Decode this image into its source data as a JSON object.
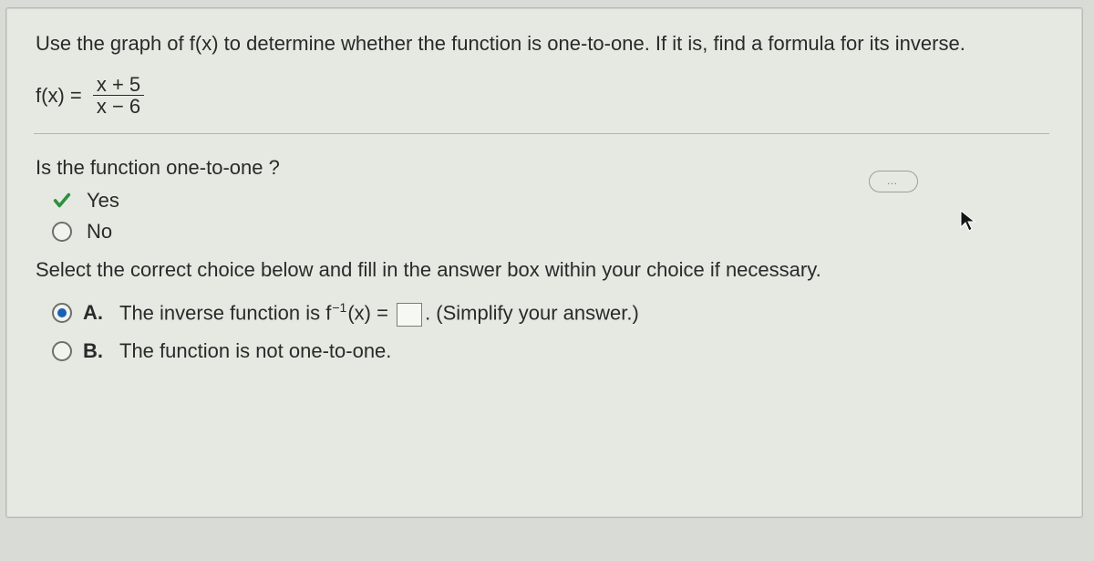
{
  "prompt": "Use the graph of f(x) to determine whether the function is one-to-one. If it is, find a formula for its inverse.",
  "function": {
    "lhs": "f(x) =",
    "numerator": "x + 5",
    "denominator": "x − 6"
  },
  "more_label": "…",
  "question1": "Is the function one-to-one ?",
  "q1_options": {
    "yes": "Yes",
    "no": "No"
  },
  "question2": "Select the correct choice below and fill in the answer box within your choice if necessary.",
  "choices": {
    "a_letter": "A.",
    "a_text_pre": "The inverse function is f",
    "a_sup": "−1",
    "a_text_mid": "(x) =",
    "a_text_post": ". (Simplify your answer.)",
    "b_letter": "B.",
    "b_text": "The function is not one-to-one."
  }
}
